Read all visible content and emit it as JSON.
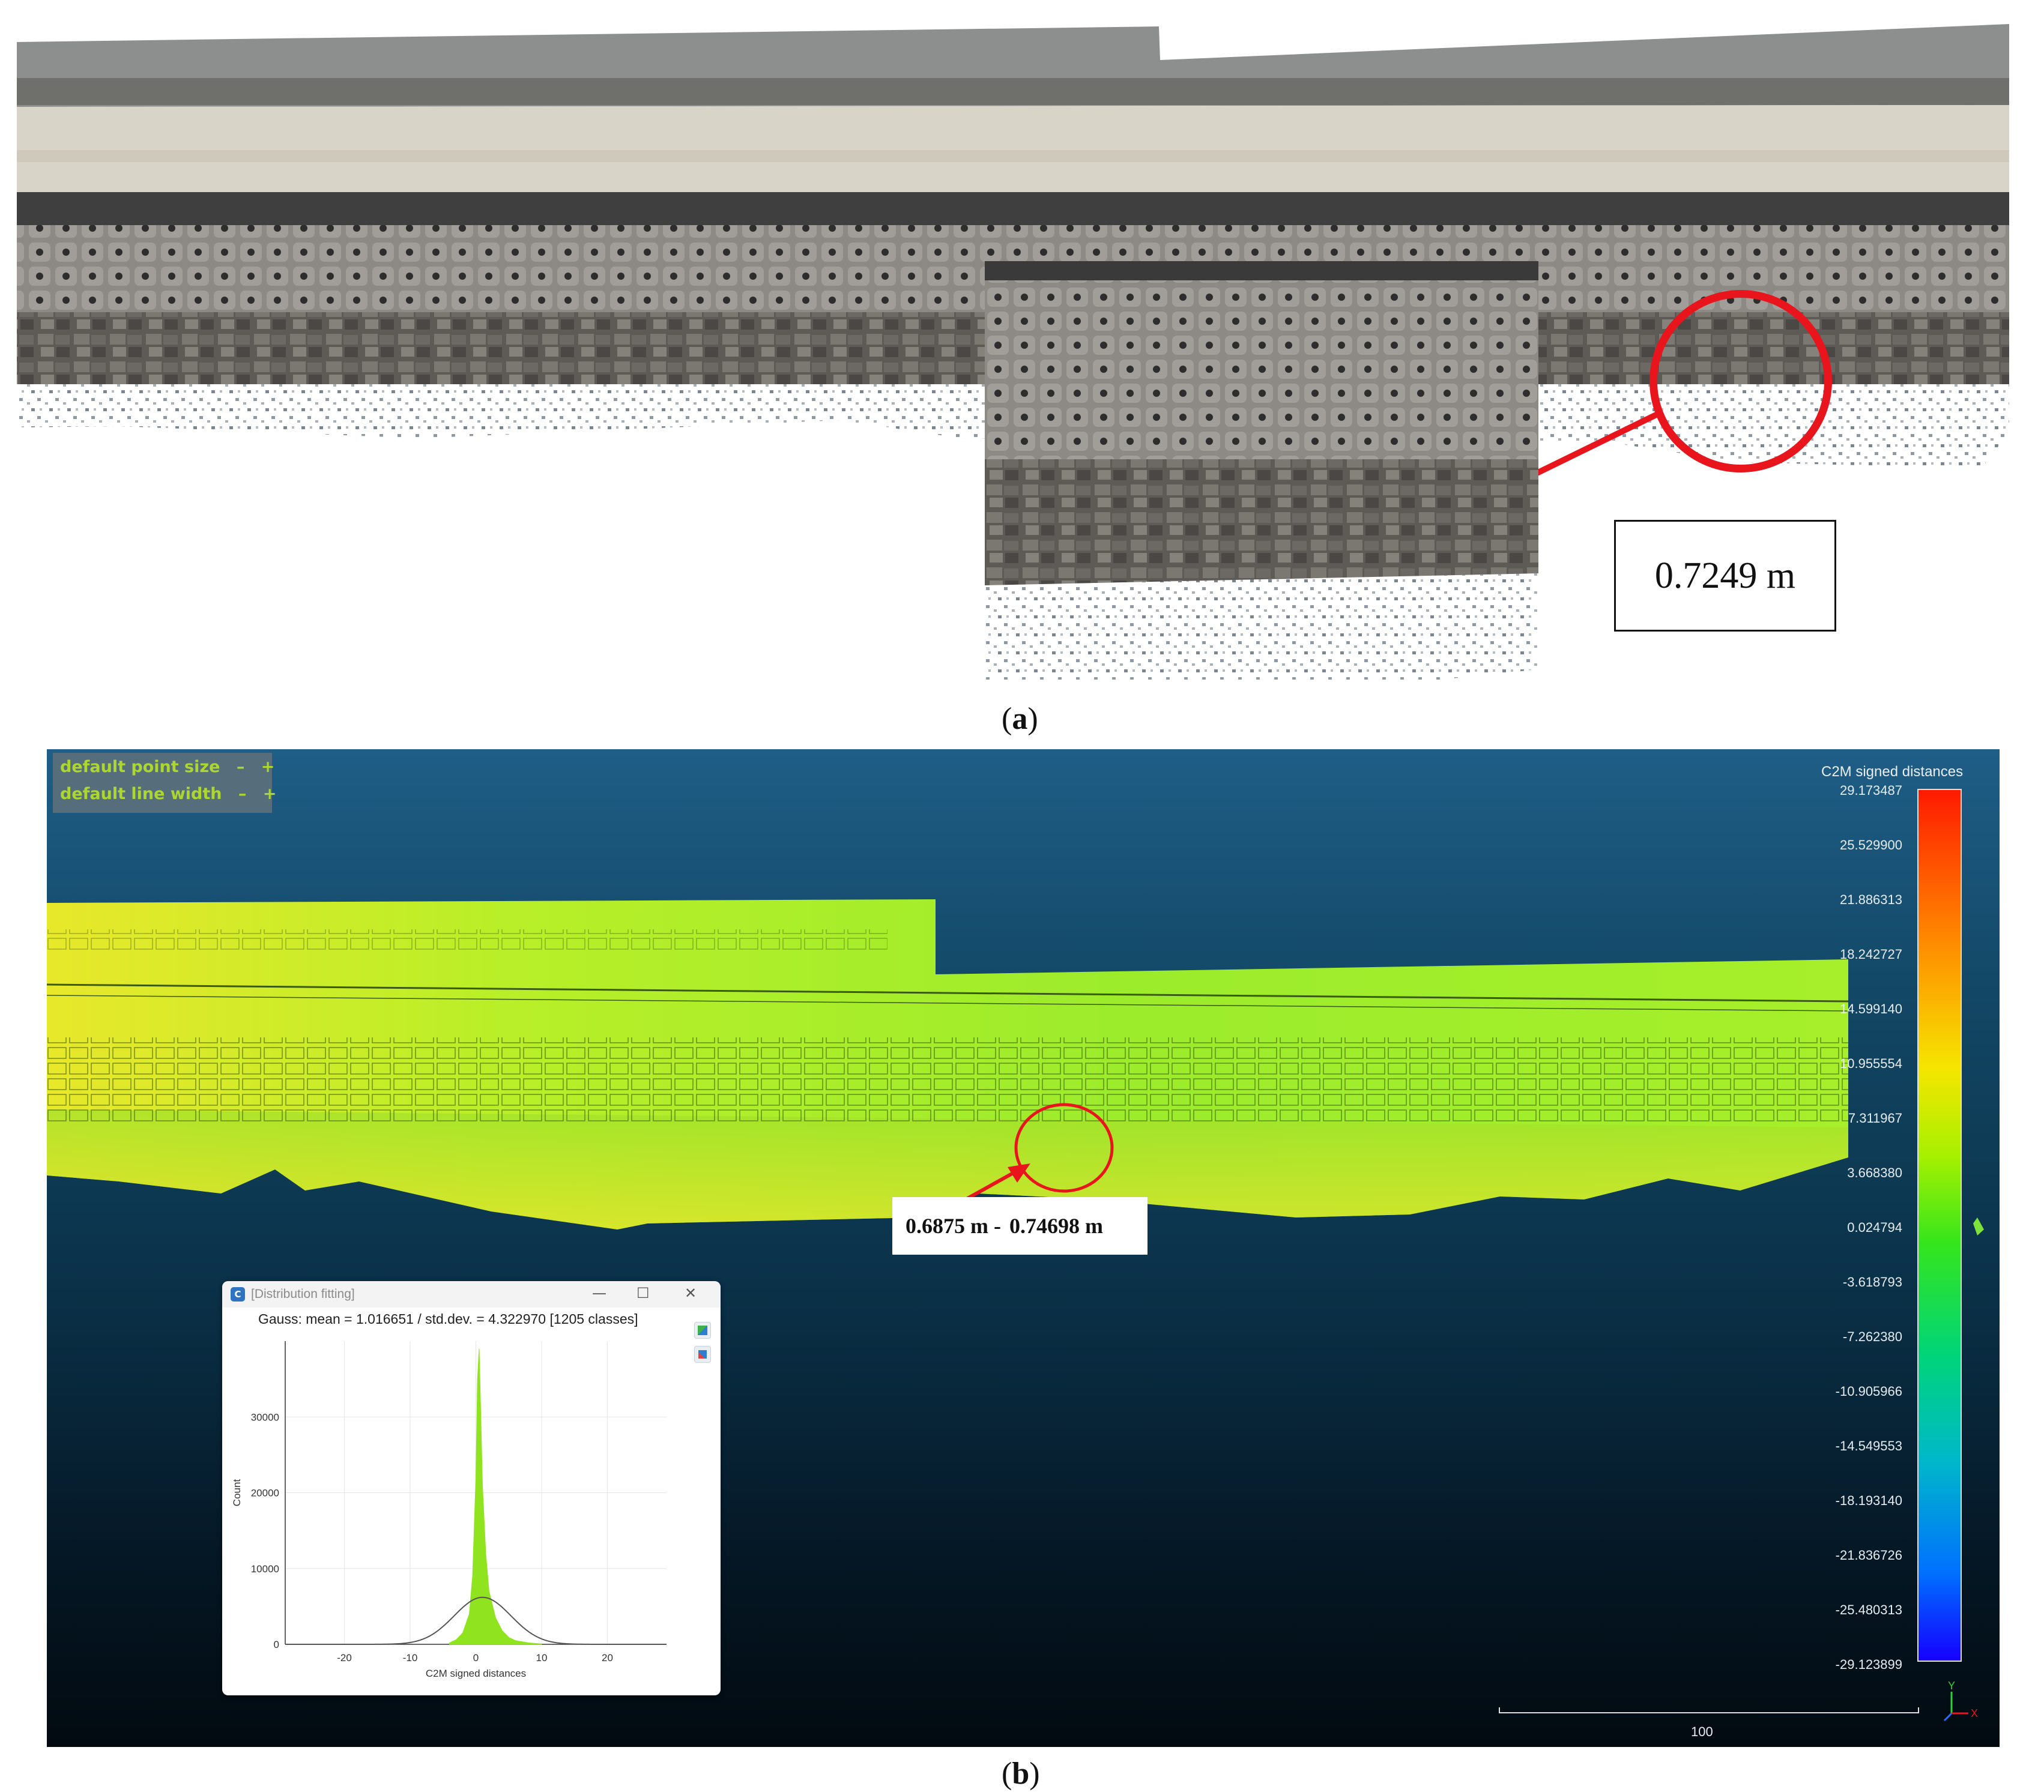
{
  "panel_a": {
    "measurement": "0.7249 m",
    "label_open": "(",
    "label_letter": "a",
    "label_close": ")"
  },
  "panel_b": {
    "label_open": "(",
    "label_letter": "b",
    "label_close": ")",
    "viewer_options": {
      "point_size_label": "default point size",
      "line_width_label": "default line width",
      "minus": "–",
      "plus": "+"
    },
    "measurement_min": "0.6875 m -",
    "measurement_max": "0.74698 m",
    "color_scale": {
      "title": "C2M signed distances",
      "ticks": [
        "29.173487",
        "25.529900",
        "21.886313",
        "18.242727",
        "14.599140",
        "10.955554",
        "7.311967",
        "3.668380",
        "0.024794",
        "-3.618793",
        "-7.262380",
        "-10.905966",
        "-14.549553",
        "-18.193140",
        "-21.836726",
        "-25.480313",
        "-29.123899"
      ],
      "colors": [
        "#ff1a00",
        "#ff8800",
        "#f5e600",
        "#a7f000",
        "#35e51c",
        "#00d47a",
        "#00b8c9",
        "#0070ff",
        "#1500ff"
      ]
    },
    "scale_ruler_label": "100",
    "axis_y": "Y",
    "axis_x": "X"
  },
  "distribution_window": {
    "title": "[Distribution fitting]",
    "app_icon": "cc-icon",
    "subtitle": "Gauss: mean = 1.016651 / std.dev. = 4.322970 [1205 classes]",
    "minimize": "—",
    "maximize": "☐",
    "close": "✕"
  },
  "chart_data": {
    "type": "area",
    "title": "",
    "xlabel": "C2M signed distances",
    "ylabel": "Count",
    "xlim": [
      -29,
      29
    ],
    "ylim": [
      0,
      40000
    ],
    "x_ticks": [
      -20,
      -10,
      0,
      10,
      20
    ],
    "y_ticks": [
      0,
      10000,
      20000,
      30000
    ],
    "histogram": {
      "x": [
        -4,
        -3,
        -2,
        -1,
        -0.5,
        0,
        0.25,
        0.5,
        0.75,
        1,
        1.5,
        2,
        3,
        4,
        5,
        6,
        8,
        10
      ],
      "values": [
        200,
        600,
        1500,
        4000,
        9000,
        22000,
        35000,
        39000,
        30000,
        21000,
        12000,
        7000,
        3500,
        1800,
        900,
        500,
        200,
        50
      ]
    },
    "gaussian": {
      "mean": 1.016651,
      "std": 4.32297,
      "peak": 6200
    }
  }
}
